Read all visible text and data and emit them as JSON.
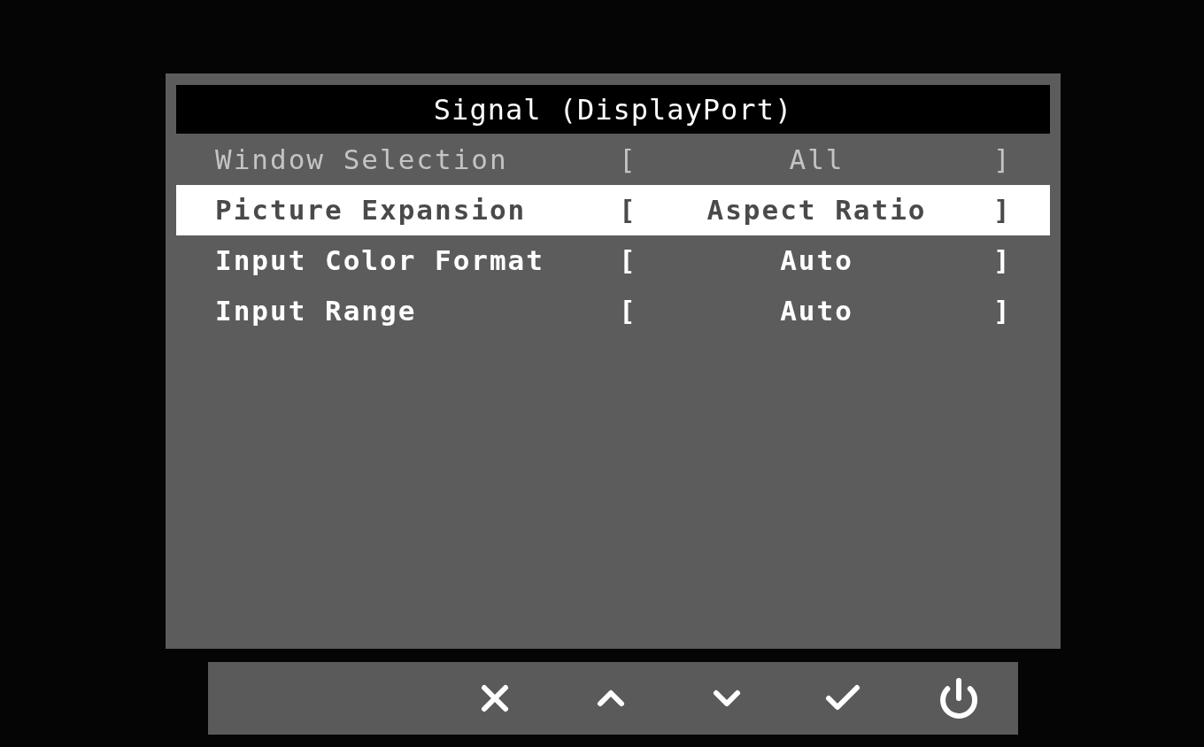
{
  "menu": {
    "title": "Signal (DisplayPort)",
    "rows": [
      {
        "label": "Window Selection",
        "open": "[",
        "value": "All",
        "close": "]",
        "selected": false,
        "disabled": true
      },
      {
        "label": "Picture Expansion",
        "open": "[",
        "value": "Aspect Ratio",
        "close": "]",
        "selected": true,
        "disabled": false
      },
      {
        "label": "Input Color Format",
        "open": "[",
        "value": "Auto",
        "close": "]",
        "selected": false,
        "disabled": false
      },
      {
        "label": "Input Range",
        "open": "[",
        "value": "Auto",
        "close": "]",
        "selected": false,
        "disabled": false
      }
    ]
  },
  "button_bar": [
    {
      "kind": "close"
    },
    {
      "kind": "up"
    },
    {
      "kind": "down"
    },
    {
      "kind": "confirm"
    },
    {
      "kind": "power"
    }
  ]
}
